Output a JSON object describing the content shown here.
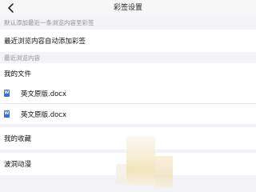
{
  "header": {
    "title": "彩签设置"
  },
  "section1": {
    "caption": "默认添加最近一条浏览内容至彩签",
    "toggle_label": "最近浏览内容自动添加彩签"
  },
  "section2": {
    "caption": "最近浏览内容",
    "groups": [
      {
        "label": "我的文件",
        "files": [
          {
            "icon": "word-doc-icon",
            "badge": "W",
            "name": "英文原版.docx"
          },
          {
            "icon": "word-doc-icon",
            "badge": "W",
            "name": "英文原版.docx"
          }
        ]
      }
    ],
    "favorites_label": "我的收藏",
    "anime_label": "波洞动漫"
  },
  "colors": {
    "word_blue": "#2f6fde",
    "background": "#f2f2f7",
    "caption_gray": "#8e8e93"
  }
}
